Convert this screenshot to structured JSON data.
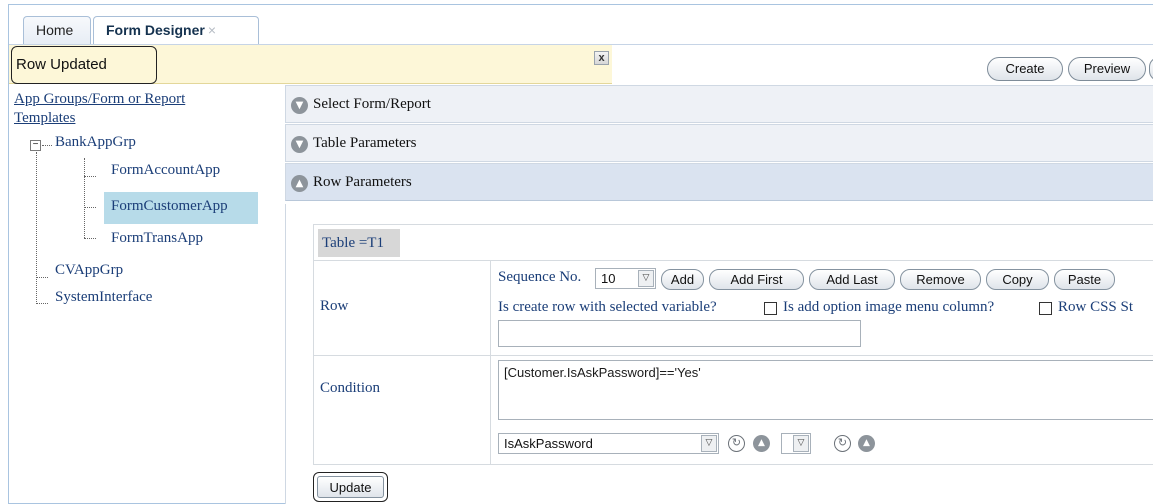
{
  "tabs": [
    {
      "label": "Home"
    },
    {
      "label": "Form Designer",
      "close": "×"
    }
  ],
  "message": {
    "text": "Row Updated",
    "close": "x"
  },
  "toolbar": {
    "create": "Create",
    "preview": "Preview"
  },
  "tree": {
    "title": "App Groups/Form or Report Templates",
    "expander": "−",
    "groups": [
      {
        "label": "BankAppGrp",
        "children": [
          "FormAccountApp",
          "FormCustomerApp",
          "FormTransApp"
        ],
        "selected": "FormCustomerApp"
      },
      {
        "label": "CVAppGrp"
      },
      {
        "label": "SystemInterface"
      }
    ]
  },
  "accordion": [
    {
      "label": "Select Form/Report",
      "icon": "chevron-down-icon"
    },
    {
      "label": "Table Parameters",
      "icon": "chevron-down-icon"
    },
    {
      "label": "Row Parameters",
      "icon": "chevron-up-icon"
    }
  ],
  "table": {
    "label": "Table =T1",
    "row_label": "Row",
    "condition_label": "Condition",
    "sequence_label": "Sequence No.",
    "sequence_value": "10",
    "buttons": [
      "Add",
      "Add First",
      "Add Last",
      "Remove",
      "Copy",
      "Paste"
    ],
    "opt_create_row": "Is create row with selected variable?",
    "opt_add_option": "Is add option image menu column?",
    "opt_row_css": "Row CSS St",
    "condition_value": "[Customer.IsAskPassword]=='Yes'",
    "variable_select": "IsAskPassword",
    "second_select": ""
  },
  "update_button": "Update"
}
